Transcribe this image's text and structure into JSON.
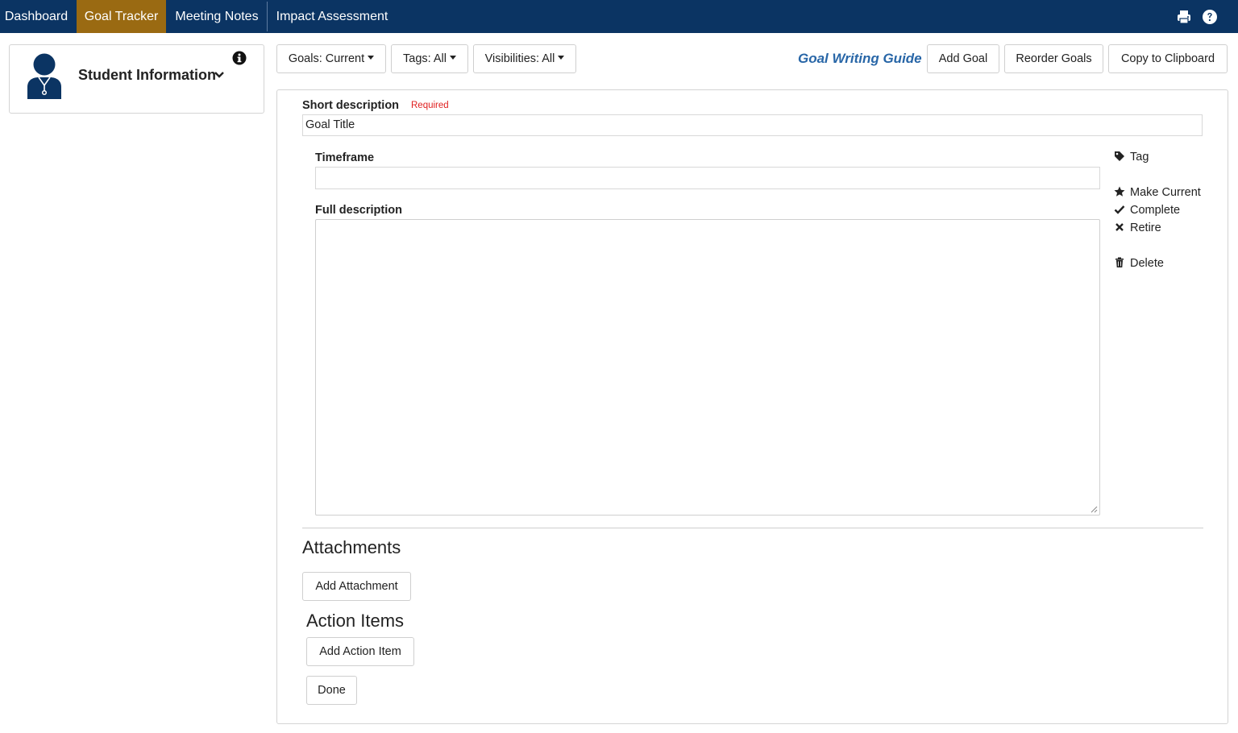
{
  "nav": {
    "tabs": [
      {
        "label": "Dashboard"
      },
      {
        "label": "Goal Tracker"
      },
      {
        "label": "Meeting Notes"
      },
      {
        "label": "Impact Assessment"
      }
    ],
    "active_tab": "Goal Tracker",
    "icons": [
      "print-icon",
      "help-icon"
    ],
    "colors": {
      "bar": "#0b3463",
      "active": "#9a6a12"
    }
  },
  "student_card": {
    "title": "Student Information",
    "icons": [
      "student-avatar-icon",
      "chevron-down-icon",
      "info-icon"
    ]
  },
  "filters": {
    "goals": "Goals: Current",
    "tags": "Tags: All",
    "visibilities": "Visibilities: All"
  },
  "toolbar": {
    "guide_link": "Goal Writing Guide",
    "add_goal": "Add Goal",
    "reorder_goals": "Reorder Goals",
    "copy_clipboard": "Copy to Clipboard"
  },
  "form": {
    "short_description_label": "Short description",
    "required_label": "Required",
    "short_description_value": "Goal Title",
    "timeframe_label": "Timeframe",
    "timeframe_value": "",
    "full_description_label": "Full description",
    "full_description_value": ""
  },
  "goal_actions": [
    {
      "label": "Tag",
      "icon": "tag-icon"
    },
    {
      "label": "Make Current",
      "icon": "star-icon"
    },
    {
      "label": "Complete",
      "icon": "check-icon"
    },
    {
      "label": "Retire",
      "icon": "close-icon"
    },
    {
      "label": "Delete",
      "icon": "trash-icon"
    }
  ],
  "attachments": {
    "heading": "Attachments",
    "add_button": "Add Attachment"
  },
  "action_items": {
    "heading": "Action Items",
    "add_button": "Add Action Item"
  },
  "done_button": "Done"
}
